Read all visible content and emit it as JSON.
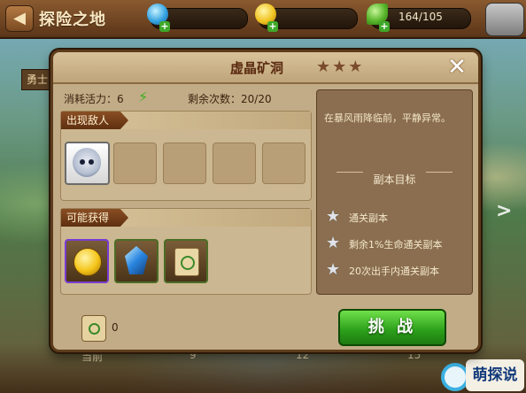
{
  "top_bar": {
    "back_label": "◀",
    "area_title": "探险之地",
    "stamina": "164/105",
    "plus": "+"
  },
  "background": {
    "left_ribbon": "勇士",
    "scale": [
      "当前",
      "9",
      "12",
      "15"
    ],
    "watermark": "萌探说"
  },
  "dialog": {
    "title": "虚晶矿洞",
    "stars": [
      "★",
      "★",
      "★"
    ],
    "close": "✕",
    "energy_cost_label": "消耗活力：6",
    "energy_icon": "⚡",
    "remaining_label": "剩余次数：20/20",
    "enemies_section": "出现敌人",
    "rewards_section": "可能获得",
    "story": "在暴风雨降临前，平静异常。",
    "goal_title": "副本目标",
    "goals": [
      "通关副本",
      "剩余1%生命通关副本",
      "20次出手内通关副本"
    ],
    "scroll_count": "0",
    "challenge_button": "挑 战"
  },
  "colors": {
    "panel": "#c2ac87",
    "header_tag": "#7a4420",
    "goal_panel": "#8a6e4f",
    "challenge_green": "#2b9e1a"
  }
}
